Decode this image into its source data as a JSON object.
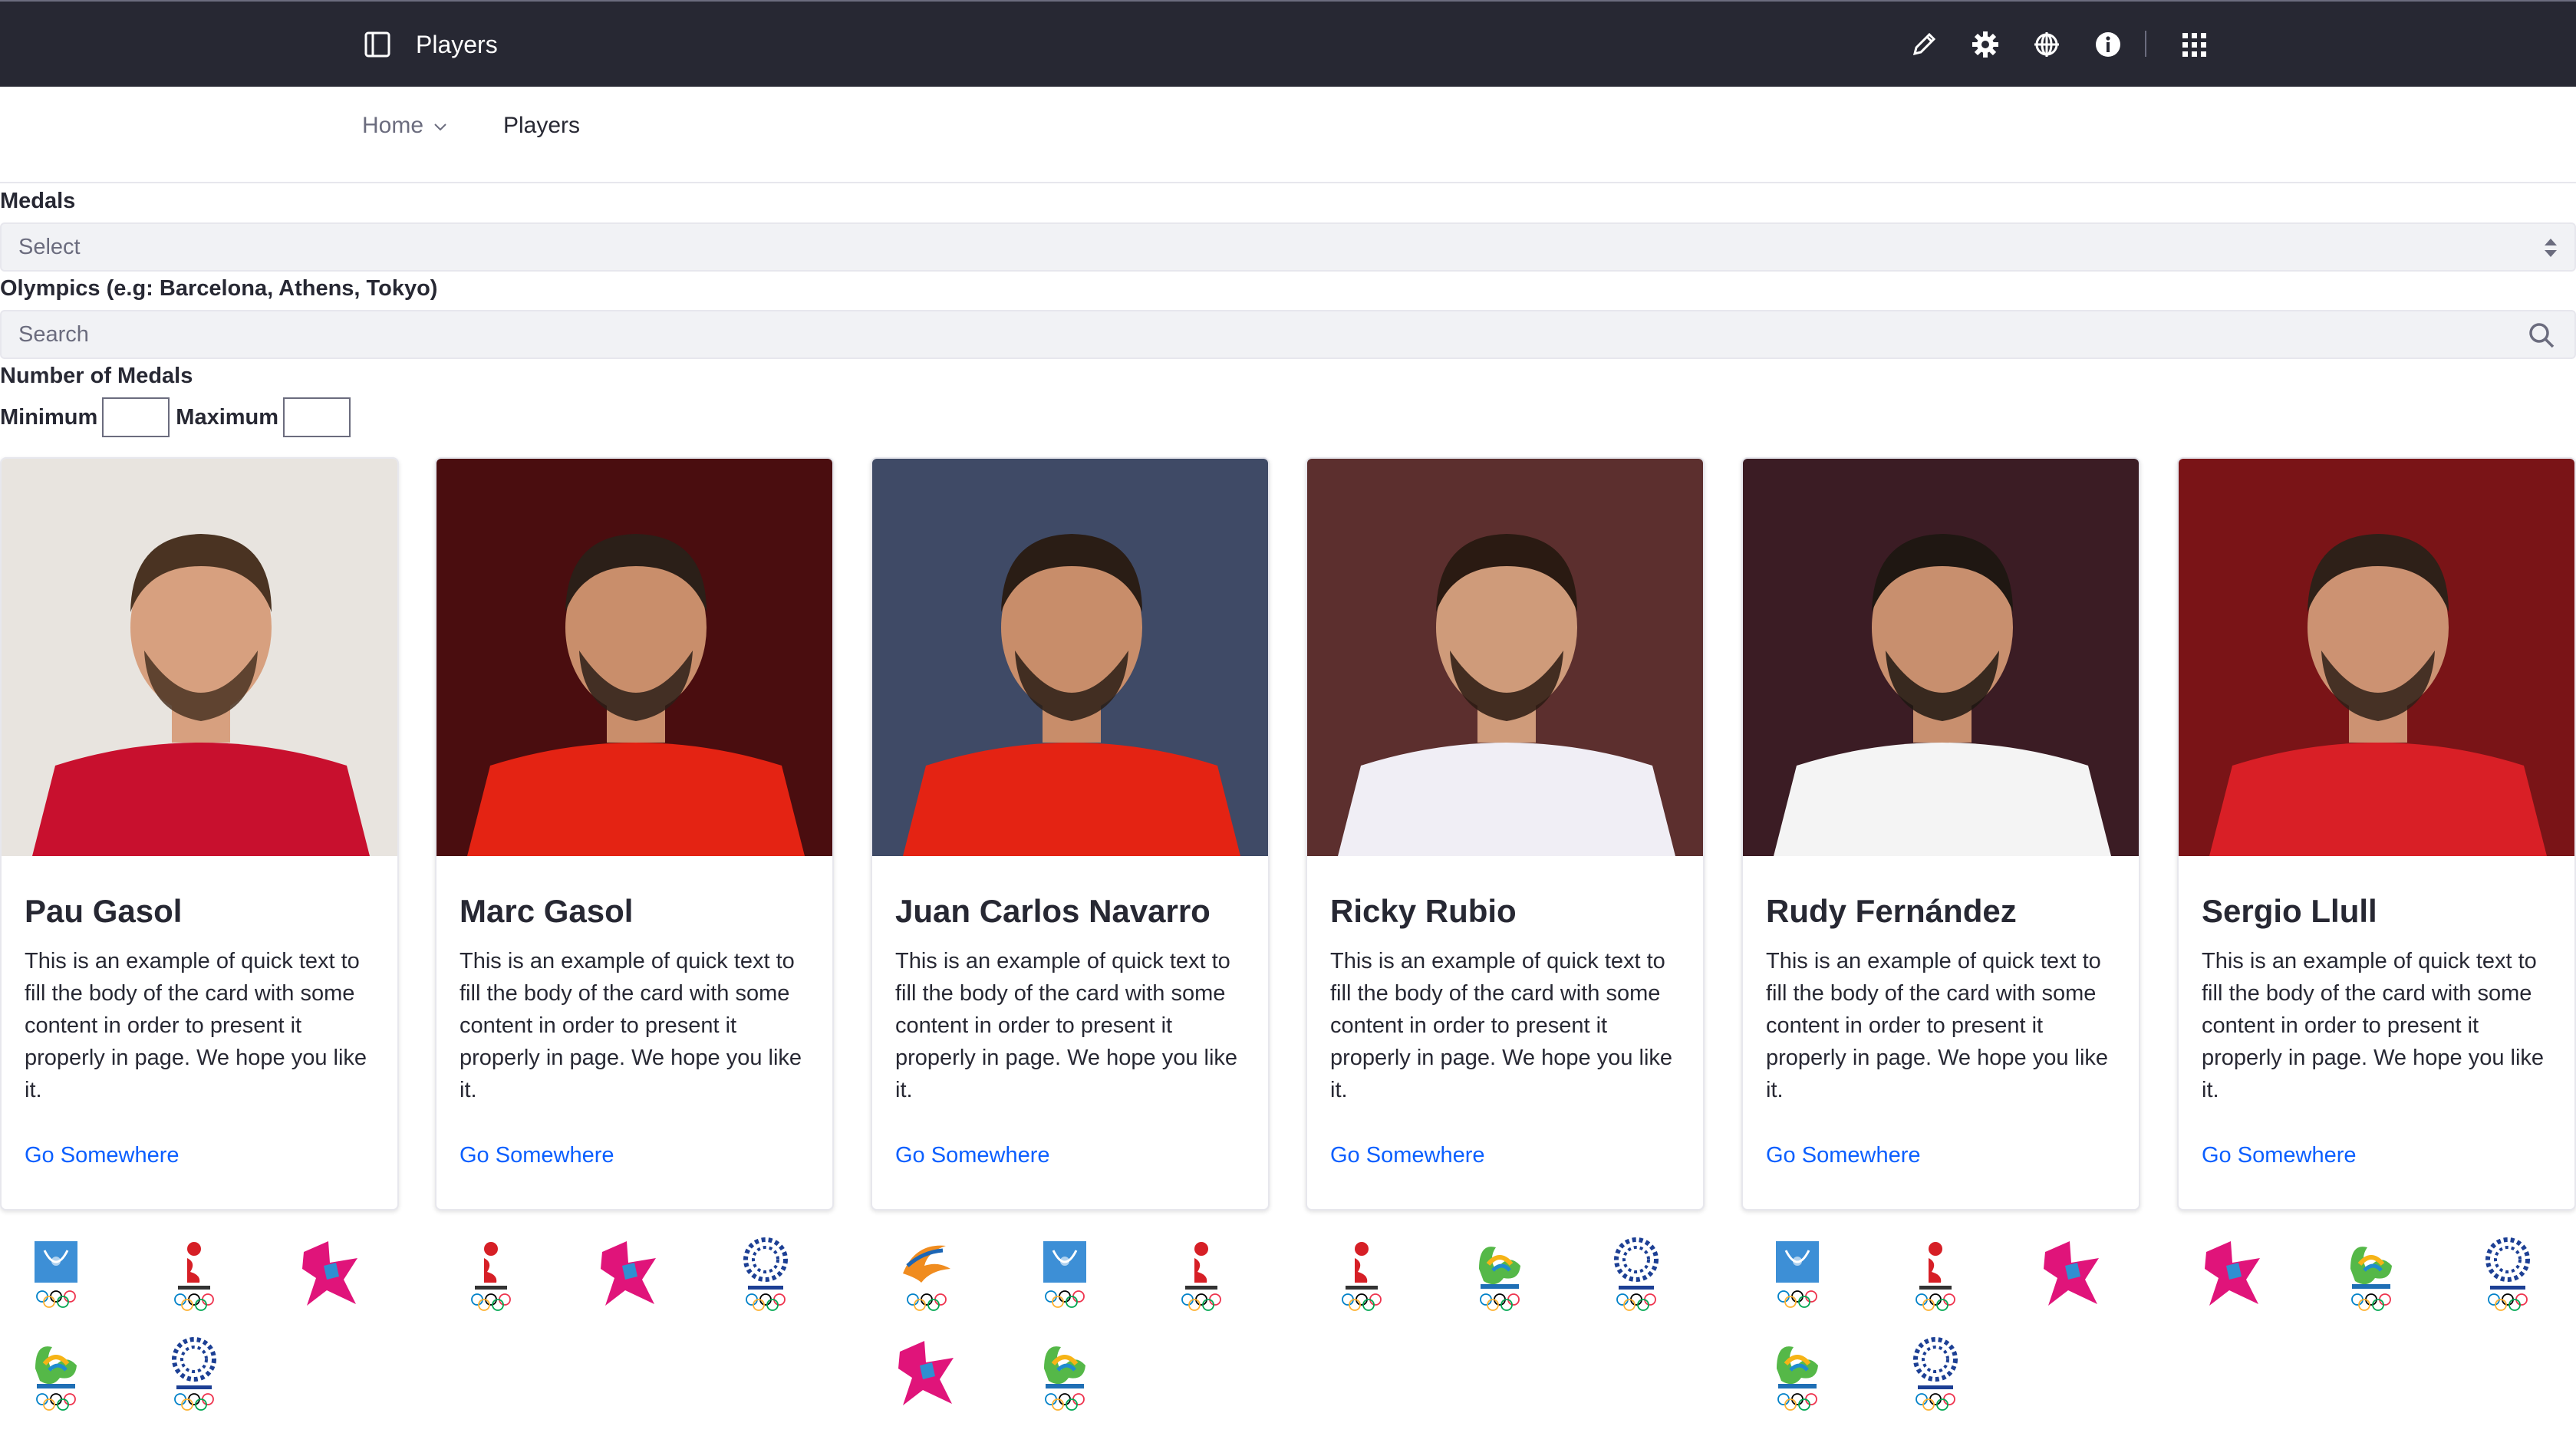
{
  "header": {
    "title": "Players"
  },
  "breadcrumb": {
    "home": "Home",
    "current": "Players"
  },
  "filters": {
    "medals_label": "Medals",
    "medals_placeholder": "Select",
    "olympics_label": "Olympics (e.g: Barcelona, Athens, Tokyo)",
    "olympics_placeholder": "Search",
    "count_label": "Number of Medals",
    "minimum_label": "Minimum",
    "maximum_label": "Maximum"
  },
  "cards": [
    {
      "name": "Pau Gasol",
      "body": "This is an example of quick text to fill the body of the card with some content in order to present it properly in page. We hope you like it.",
      "link": "Go Somewhere",
      "jersey": "#c8102e",
      "skin": "#d7a07f",
      "hair": "#4a3322"
    },
    {
      "name": "Marc Gasol",
      "body": "This is an example of quick text to fill the body of the card with some content in order to present it properly in page. We hope you like it.",
      "link": "Go Somewhere",
      "jersey": "#e42313",
      "skin": "#c98e6b",
      "hair": "#2b1f18"
    },
    {
      "name": "Juan Carlos Navarro",
      "body": "This is an example of quick text to fill the body of the card with some content in order to present it properly in page. We hope you like it.",
      "link": "Go Somewhere",
      "jersey": "#e42313",
      "skin": "#c88d6a",
      "hair": "#2a1d15"
    },
    {
      "name": "Ricky Rubio",
      "body": "This is an example of quick text to fill the body of the card with some content in order to present it properly in page. We hope you like it.",
      "link": "Go Somewhere",
      "jersey": "#f0eef5",
      "skin": "#cf9b7a",
      "hair": "#2a1a12"
    },
    {
      "name": "Rudy Fernández",
      "body": "This is an example of quick text to fill the body of the card with some content in order to present it properly in page. We hope you like it.",
      "link": "Go Somewhere",
      "jersey": "#f4f4f4",
      "skin": "#c88f6e",
      "hair": "#1f1712"
    },
    {
      "name": "Sergio Llull",
      "body": "This is an example of quick text to fill the body of the card with some content in order to present it properly in page. We hope you like it.",
      "link": "Go Somewhere",
      "jersey": "#d91f26",
      "skin": "#cc9272",
      "hair": "#2e2018"
    }
  ],
  "medal_logos": [
    [
      "athens-2004",
      "beijing-2008",
      "london-2012",
      "rio-2016",
      "tokyo-2020"
    ],
    [
      "beijing-2008",
      "london-2012",
      "tokyo-2020"
    ],
    [
      "sydney-2000",
      "athens-2004",
      "beijing-2008",
      "london-2012",
      "rio-2016"
    ],
    [
      "beijing-2008",
      "rio-2016",
      "tokyo-2020"
    ],
    [
      "athens-2004",
      "beijing-2008",
      "london-2012",
      "rio-2016",
      "tokyo-2020"
    ],
    [
      "london-2012",
      "rio-2016",
      "tokyo-2020"
    ]
  ]
}
